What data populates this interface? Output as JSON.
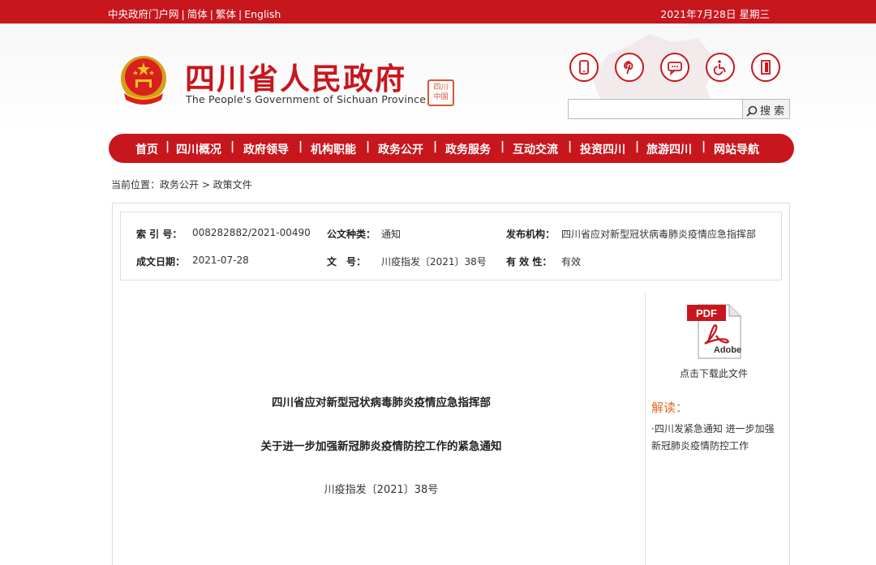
{
  "topbar": {
    "links": [
      "中央政府门户网",
      "简体",
      "繁体",
      "English"
    ],
    "date": "2021年7月28日 星期三"
  },
  "header": {
    "title": "四川省人民政府",
    "subtitle": "The People's Government of Sichuan Province",
    "seal_text": "四川 中国",
    "search_placeholder": "",
    "search_button": "搜 索",
    "tool_icons": [
      "mobile-icon",
      "pinterest-icon",
      "message-icon",
      "accessibility-icon",
      "exit-icon"
    ]
  },
  "nav": {
    "items": [
      "首页",
      "四川概况",
      "政府领导",
      "机构职能",
      "政务公开",
      "政务服务",
      "互动交流",
      "投资四川",
      "旅游四川",
      "网站导航"
    ]
  },
  "breadcrumb": {
    "text": "当前位置：政务公开 > 政策文件"
  },
  "meta": {
    "index_label": "索 引 号：",
    "index_value": "008282882/2021-00490",
    "type_label": "公文种类：",
    "type_value": "通知",
    "publisher_label": "发布机构：",
    "publisher_value": "四川省应对新型冠状病毒肺炎疫情应急指挥部",
    "date_label": "成文日期：",
    "date_value": "2021-07-28",
    "docno_label": "文　号：",
    "docno_value": "川疫指发〔2021〕38号",
    "validity_label": "有 效 性：",
    "validity_value": "有效"
  },
  "document": {
    "title1": "四川省应对新型冠状病毒肺炎疫情应急指挥部",
    "title2": "关于进一步加强新冠肺炎疫情防控工作的紧急通知",
    "number": "川疫指发〔2021〕38号"
  },
  "sidebar": {
    "pdf_badge": "PDF",
    "pdf_brand": "Adobe",
    "download_label": "点击下载此文件",
    "interp_title": "解读：",
    "interp_link": "·四川发紧急通知 进一步加强新冠肺炎疫情防控工作"
  },
  "colors": {
    "brand_red": "#c8161d",
    "accent_orange": "#e06a1b"
  }
}
